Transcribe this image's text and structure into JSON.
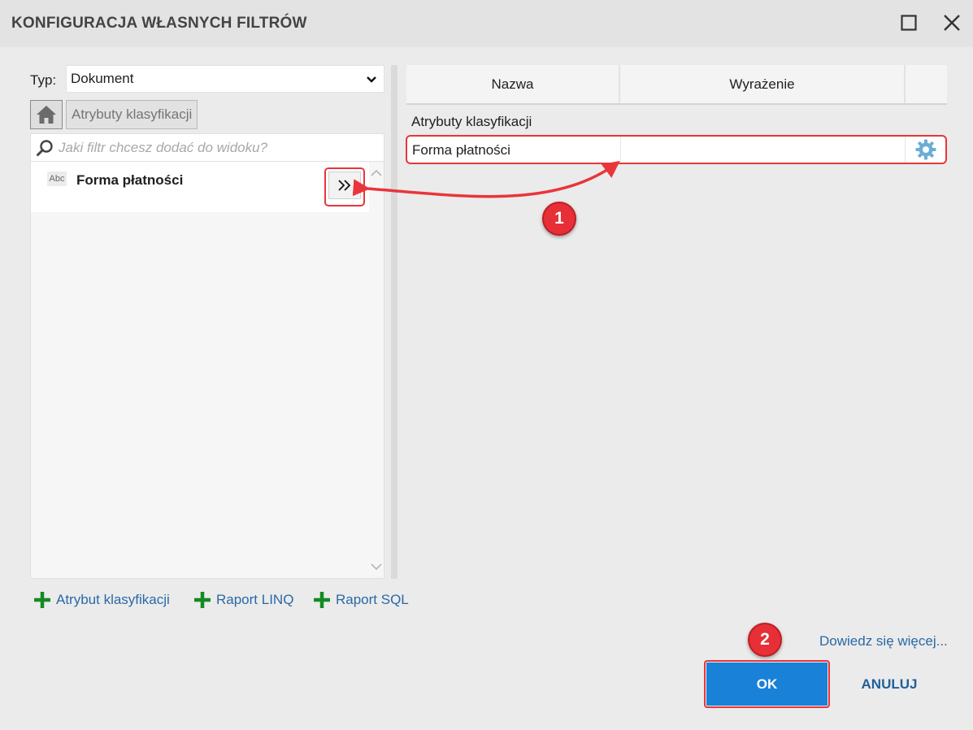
{
  "window": {
    "title": "KONFIGURACJA WŁASNYCH FILTRÓW",
    "maximize_icon": "maximize-icon",
    "close_icon": "close-icon"
  },
  "left_panel": {
    "type_label": "Typ:",
    "type_value": "Dokument",
    "breadcrumb_home_icon": "home-icon",
    "breadcrumb_current": "Atrybuty klasyfikacji",
    "search_placeholder": "Jaki filtr chcesz dodać do widoku?",
    "search_value": "",
    "items": [
      {
        "icon": "Abc",
        "label": "Forma płatności"
      }
    ]
  },
  "grid": {
    "columns": [
      "Nazwa",
      "Wyrażenie",
      ""
    ],
    "group_label": "Atrybuty klasyfikacji",
    "rows": [
      {
        "name": "Forma płatności",
        "expression": ""
      }
    ]
  },
  "bottom_links": [
    {
      "label": "Atrybut klasyfikacji"
    },
    {
      "label": "Raport LINQ"
    },
    {
      "label": "Raport SQL"
    }
  ],
  "annotations": {
    "badge_1": "1",
    "badge_2": "2"
  },
  "footer": {
    "learn_more": "Dowiedz się więcej...",
    "ok_label": "OK",
    "cancel_label": "ANULUJ"
  },
  "colors": {
    "accent_blue": "#1982d8",
    "link_blue": "#2a69a6",
    "plus_green": "#138a24",
    "annotation_red": "#e62f36",
    "gear_blue": "#6aaed6"
  }
}
